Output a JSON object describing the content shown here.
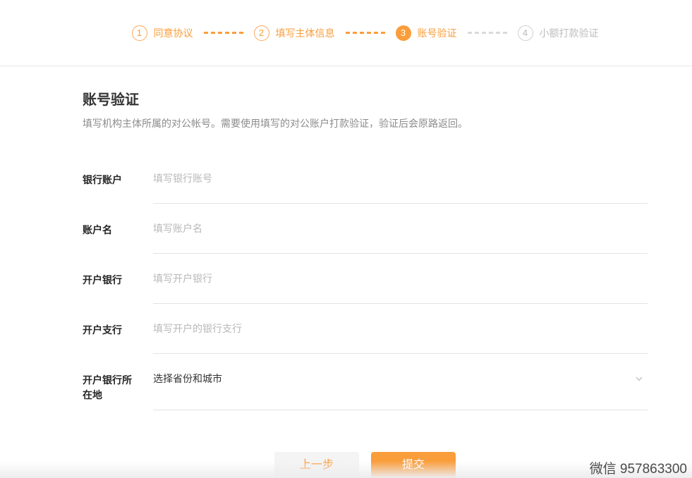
{
  "stepper": {
    "steps": [
      {
        "number": "1",
        "label": "同意协议",
        "state": "done"
      },
      {
        "number": "2",
        "label": "填写主体信息",
        "state": "done"
      },
      {
        "number": "3",
        "label": "账号验证",
        "state": "current"
      },
      {
        "number": "4",
        "label": "小额打款验证",
        "state": "pending"
      }
    ]
  },
  "section": {
    "title": "账号验证",
    "description": "填写机构主体所属的对公帐号。需要使用填写的对公账户打款验证，验证后会原路返回。"
  },
  "form": {
    "fields": [
      {
        "label": "银行账户",
        "placeholder": "填写银行账号",
        "type": "text"
      },
      {
        "label": "账户名",
        "placeholder": "填写账户名",
        "type": "text"
      },
      {
        "label": "开户银行",
        "placeholder": "填写开户银行",
        "type": "text"
      },
      {
        "label": "开户支行",
        "placeholder": "填写开户的银行支行",
        "type": "text"
      },
      {
        "label": "开户银行所在地",
        "value": "选择省份和城市",
        "type": "select"
      }
    ],
    "prev_label": "上一步",
    "submit_label": "提交"
  },
  "watermark": "微信 957863300",
  "colors": {
    "accent": "#fa9d3b",
    "pending_gray": "#bdbdbd",
    "divider": "#e3e3e3"
  },
  "icons": {
    "chevron_down": "chevron-down-icon"
  }
}
